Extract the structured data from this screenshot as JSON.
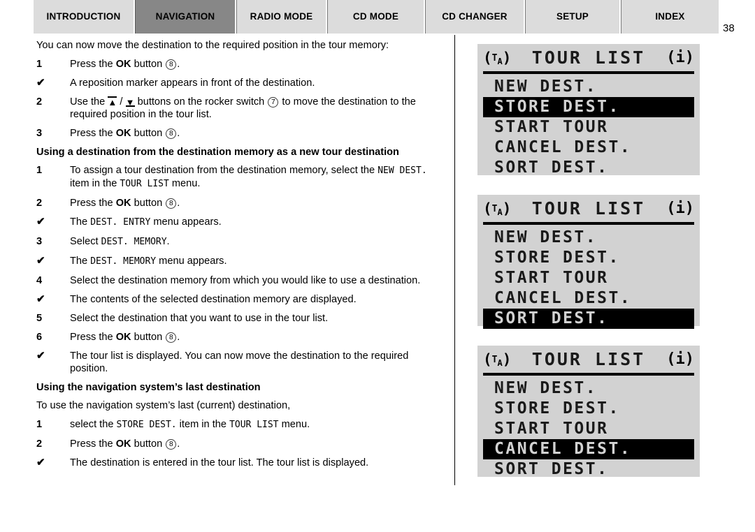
{
  "page_number": "38",
  "tabs": [
    {
      "label": "INTRODUCTION",
      "active": false
    },
    {
      "label": "NAVIGATION",
      "active": true
    },
    {
      "label": "RADIO MODE",
      "active": false
    },
    {
      "label": "CD MODE",
      "active": false
    },
    {
      "label": "CD CHANGER",
      "active": false
    },
    {
      "label": "SETUP",
      "active": false
    },
    {
      "label": "INDEX",
      "active": false
    }
  ],
  "content": {
    "intro": "You can now move the destination to the required position in the tour memory:",
    "step1_marker": "1",
    "step1_a": "Press the ",
    "step1_ok": "OK",
    "step1_b": " button ",
    "step1_badge": "8",
    "step1_end": ".",
    "check1_marker": "✔",
    "check1_text": "A reposition marker appears in front of the destination.",
    "step2_marker": "2",
    "step2_a": "Use the ",
    "step2_slash": " / ",
    "step2_b": " buttons on the rocker switch ",
    "step2_badge": "7",
    "step2_c": " to move the destination to the required position in the tour list.",
    "step3_marker": "3",
    "step3_a": "Press the ",
    "step3_ok": "OK",
    "step3_b": " button ",
    "step3_badge": "8",
    "step3_end": ".",
    "heading1": "Using a destination from the destination memory as a new tour destination",
    "s1_marker": "1",
    "s1_a": "To assign a tour destination from the destination memory, select the ",
    "s1_mono1": "NEW DEST.",
    "s1_b": " item in the ",
    "s1_mono2": "TOUR LIST",
    "s1_c": " menu.",
    "s2_marker": "2",
    "s2_a": "Press the ",
    "s2_ok": "OK",
    "s2_b": " button ",
    "s2_badge": "8",
    "s2_end": ".",
    "c2_marker": "✔",
    "c2_a": "The ",
    "c2_mono": "DEST. ENTRY",
    "c2_b": " menu appears.",
    "s3_marker": "3",
    "s3_a": "Select ",
    "s3_mono": "DEST. MEMORY",
    "s3_b": ".",
    "c3_marker": "✔",
    "c3_a": "The ",
    "c3_mono": "DEST. MEMORY",
    "c3_b": " menu appears.",
    "s4_marker": "4",
    "s4_text": "Select the destination memory from which you would like to use a destination.",
    "c4_marker": "✔",
    "c4_text": "The contents of the selected destination memory are displayed.",
    "s5_marker": "5",
    "s5_text": "Select the destination that you want to use in the tour list.",
    "s6_marker": "6",
    "s6_a": "Press the ",
    "s6_ok": "OK",
    "s6_b": " button ",
    "s6_badge": "8",
    "s6_end": ".",
    "c6_marker": "✔",
    "c6_text": "The tour list is displayed. You can now move the destination to the required position.",
    "heading2": "Using the navigation system’s last destination",
    "para2": "To use the navigation system’s last (current) destination,",
    "n1_marker": "1",
    "n1_a": "select the ",
    "n1_mono1": "STORE DEST.",
    "n1_b": " item in the ",
    "n1_mono2": "TOUR LIST",
    "n1_c": " menu.",
    "n2_marker": "2",
    "n2_a": "Press the ",
    "n2_ok": "OK",
    "n2_b": " button ",
    "n2_badge": "8",
    "n2_end": ".",
    "cn_marker": "✔",
    "cn_text": "The destination is entered in the tour list. The tour list is displayed."
  },
  "lcd_panels": [
    {
      "ta_label": "TA",
      "title": "TOUR LIST",
      "info_label": "i",
      "items": [
        {
          "label": "NEW DEST.",
          "selected": false
        },
        {
          "label": "STORE DEST.",
          "selected": true
        },
        {
          "label": "START TOUR",
          "selected": false
        },
        {
          "label": "CANCEL DEST.",
          "selected": false
        },
        {
          "label": "SORT DEST.",
          "selected": false
        }
      ]
    },
    {
      "ta_label": "TA",
      "title": "TOUR LIST",
      "info_label": "i",
      "items": [
        {
          "label": "NEW DEST.",
          "selected": false
        },
        {
          "label": "STORE DEST.",
          "selected": false
        },
        {
          "label": "START TOUR",
          "selected": false
        },
        {
          "label": "CANCEL DEST.",
          "selected": false
        },
        {
          "label": "SORT DEST.",
          "selected": true
        }
      ]
    },
    {
      "ta_label": "TA",
      "title": "TOUR LIST",
      "info_label": "i",
      "items": [
        {
          "label": "NEW DEST.",
          "selected": false
        },
        {
          "label": "STORE DEST.",
          "selected": false
        },
        {
          "label": "START TOUR",
          "selected": false
        },
        {
          "label": "CANCEL DEST.",
          "selected": true
        },
        {
          "label": "SORT DEST.",
          "selected": false
        }
      ]
    }
  ],
  "colors": {
    "tab_inactive": "#dcdcdc",
    "tab_active": "#878787",
    "lcd_background": "#d2d2d2",
    "lcd_selected": "#000000"
  }
}
